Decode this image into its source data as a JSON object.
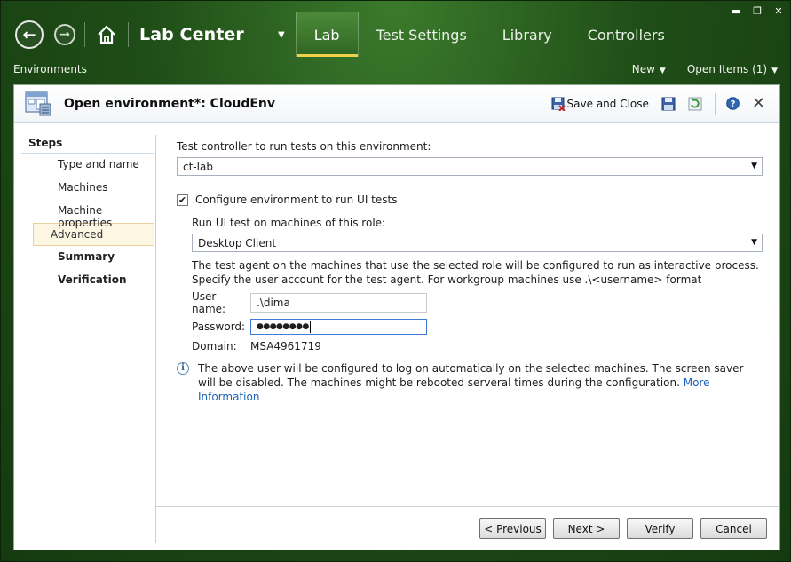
{
  "window": {
    "minimize": "▬",
    "restore": "❐",
    "close": "✕"
  },
  "nav": {
    "back_glyph": "←",
    "forward_glyph": "→",
    "app_title": "Lab Center",
    "dropdown_glyph": "▼",
    "tabs": [
      {
        "label": "Lab",
        "active": true
      },
      {
        "label": "Test Settings",
        "active": false
      },
      {
        "label": "Library",
        "active": false
      },
      {
        "label": "Controllers",
        "active": false
      }
    ]
  },
  "subbar": {
    "section": "Environments",
    "new_label": "New",
    "open_items_label": "Open Items (1)",
    "caret": "▼"
  },
  "panel": {
    "title": "Open environment*: CloudEnv",
    "save_close_label": "Save and Close",
    "close_glyph": "✕"
  },
  "steps": {
    "title": "Steps",
    "items": [
      {
        "label": "Type and name"
      },
      {
        "label": "Machines"
      },
      {
        "label": "Machine properties"
      },
      {
        "label": "Advanced"
      },
      {
        "label": "Summary"
      },
      {
        "label": "Verification"
      }
    ]
  },
  "form": {
    "controller_label": "Test controller to run tests on this environment:",
    "controller_value": "ct-lab",
    "configure_ui_label": "Configure environment to run UI tests",
    "configure_ui_checked": "✔",
    "role_label": "Run UI test on machines of this role:",
    "role_value": "Desktop Client",
    "desc_line1": "The test agent on the machines that use the selected role will be configured to run as interactive process.",
    "desc_line2": "Specify the user account for the test agent. For workgroup machines use .\\<username> format",
    "username_label": "User name:",
    "username_value": ".\\dima",
    "password_label": "Password:",
    "password_value": "●●●●●●●●",
    "domain_label": "Domain:",
    "domain_value": "MSA4961719",
    "info_glyph": "i",
    "info_text": "The above user will be configured to log on automatically on the selected machines. The screen saver will be disabled. The machines might be rebooted serveral times during the configuration.",
    "more_info_link": "More Information",
    "arrow": "▼"
  },
  "footer": {
    "previous": "< Previous",
    "next": "Next >",
    "verify": "Verify",
    "cancel": "Cancel"
  }
}
